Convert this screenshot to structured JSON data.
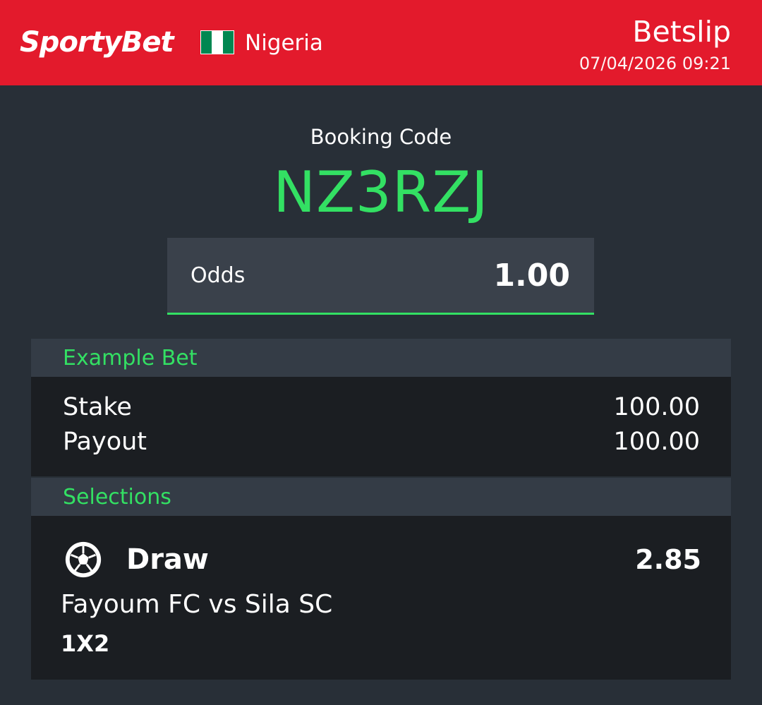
{
  "header": {
    "brand": "SportyBet",
    "country": "Nigeria",
    "title": "Betslip",
    "datetime": "07/04/2026 09:21",
    "colors": {
      "background": "#e31a2c",
      "flag_green": "#008751",
      "flag_white": "#ffffff"
    }
  },
  "booking": {
    "label": "Booking Code",
    "code": "NZ3RZJ",
    "accent_color": "#33e063"
  },
  "odds": {
    "label": "Odds",
    "value": "1.00"
  },
  "example_bet": {
    "title": "Example Bet",
    "rows": [
      {
        "label": "Stake",
        "value": "100.00"
      },
      {
        "label": "Payout",
        "value": "100.00"
      }
    ]
  },
  "selections": {
    "title": "Selections",
    "items": [
      {
        "icon": "soccer-ball-icon",
        "pick": "Draw",
        "odds": "2.85",
        "match": "Fayoum FC vs Sila SC",
        "market": "1X2"
      }
    ]
  }
}
